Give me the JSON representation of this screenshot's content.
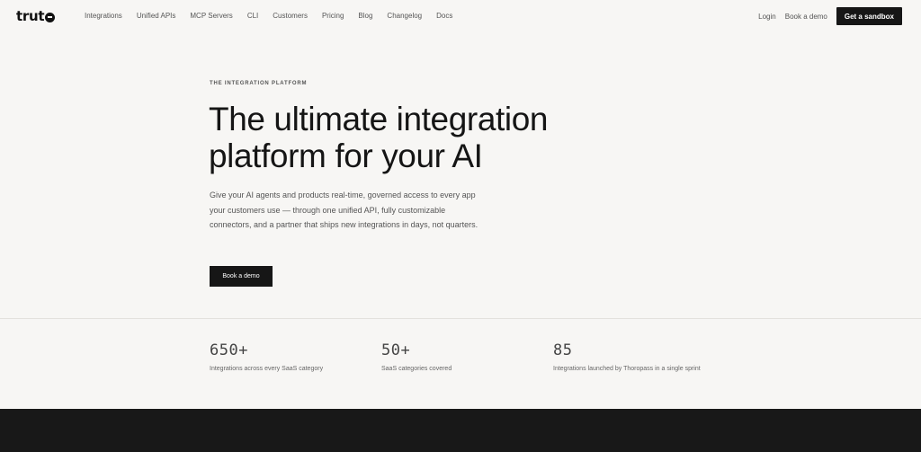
{
  "nav": {
    "logo": "trut",
    "links": [
      "Integrations",
      "Unified APIs",
      "MCP Servers",
      "CLI",
      "Customers",
      "Pricing",
      "Blog",
      "Changelog",
      "Docs"
    ],
    "login": "Login",
    "book_demo": "Book a demo",
    "sandbox": "Get a sandbox"
  },
  "hero": {
    "eyebrow": "THE INTEGRATION PLATFORM",
    "headline": "The ultimate integration platform for your AI",
    "subtext": "Give your AI agents and products real-time, governed access to every app your customers use — through one unified API, fully customizable connectors, and a partner that ships new integrations in days, not quarters.",
    "cta": "Book a demo"
  },
  "stats": [
    {
      "value": "650+",
      "label": "Integrations across every SaaS category"
    },
    {
      "value": "50+",
      "label": "SaaS categories covered"
    },
    {
      "value": "85",
      "label": "Integrations launched by Thoropass in a single sprint"
    }
  ]
}
